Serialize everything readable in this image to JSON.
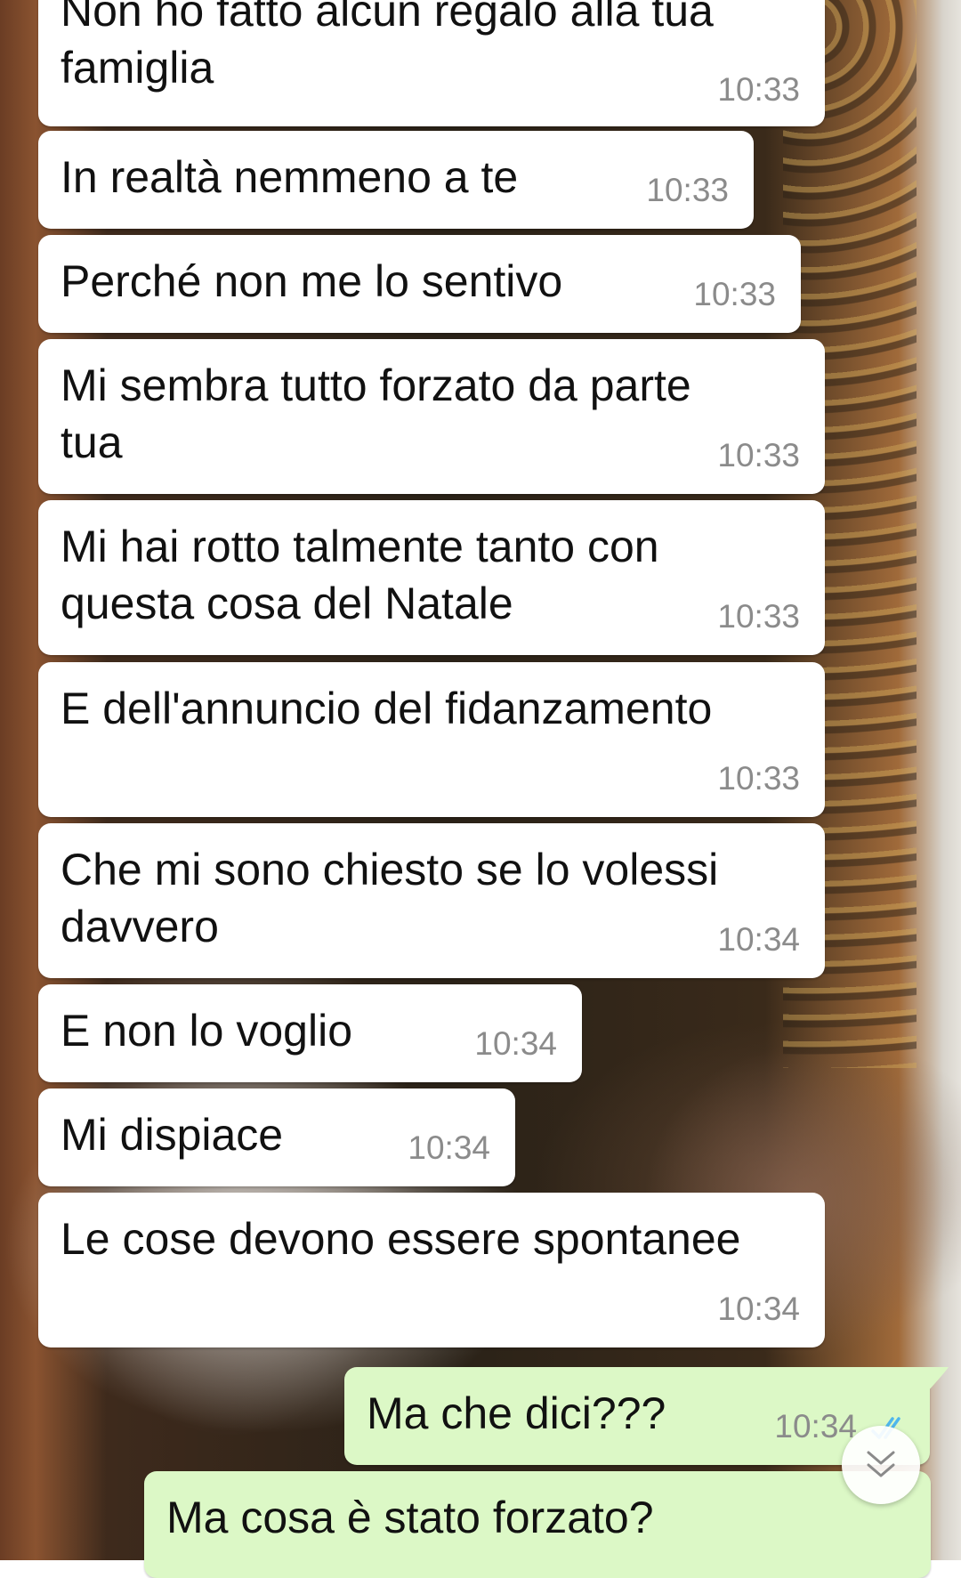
{
  "messages": [
    {
      "text_lines": [
        "Non ho fatto alcun regalo alla tua",
        "famiglia"
      ],
      "time": "10:33"
    },
    {
      "text_lines": [
        "In realtà nemmeno a te"
      ],
      "time": "10:33"
    },
    {
      "text_lines": [
        "Perché non me lo sentivo"
      ],
      "time": "10:33"
    },
    {
      "text_lines": [
        "Mi sembra tutto forzato da parte",
        "tua"
      ],
      "time": "10:33"
    },
    {
      "text_lines": [
        "Mi hai rotto talmente tanto con",
        "questa cosa del Natale"
      ],
      "time": "10:33"
    },
    {
      "text_lines": [
        "E dell'annuncio del fidanzamento"
      ],
      "time": "10:33"
    },
    {
      "text_lines": [
        "Che mi sono chiesto se lo volessi",
        "davvero"
      ],
      "time": "10:34"
    },
    {
      "text_lines": [
        "E non lo voglio"
      ],
      "time": "10:34"
    },
    {
      "text_lines": [
        "Mi dispiace"
      ],
      "time": "10:34"
    },
    {
      "text_lines": [
        "Le cose devono essere spontanee"
      ],
      "time": "10:34"
    },
    {
      "text_lines": [
        "Ma che  dici???"
      ],
      "time": "10:34",
      "status_icon": "double-check-icon"
    },
    {
      "text_lines": [
        "Ma cosa è stato forzato?"
      ],
      "time": ""
    }
  ],
  "scroll_button": {
    "icon": "double-chevron-down-icon"
  },
  "colors": {
    "incoming_bubble": "#ffffff",
    "outgoing_bubble": "#dcf8c6",
    "read_tick": "#4fb6ec",
    "timestamp": "#8b8b8b"
  }
}
